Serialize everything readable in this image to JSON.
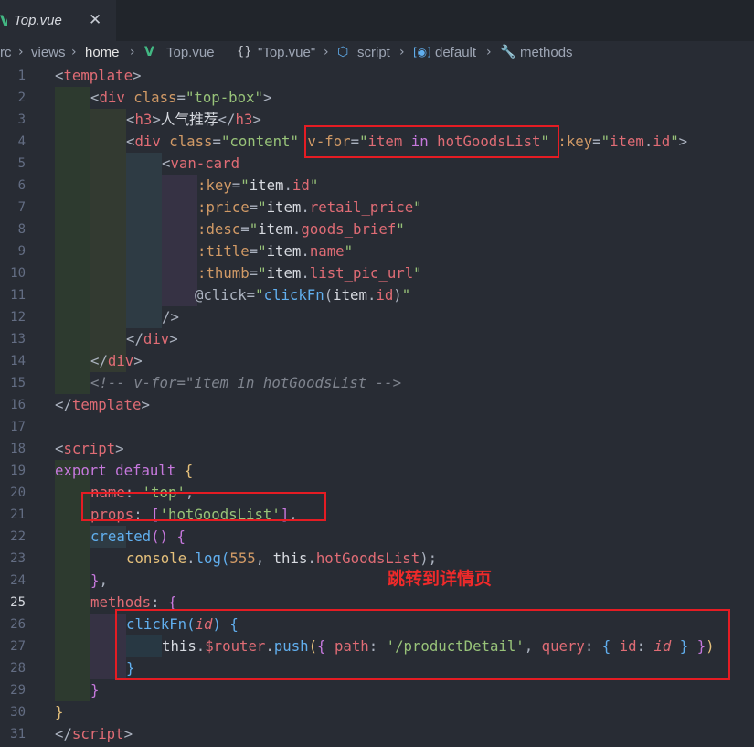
{
  "tab": {
    "icon": "vue-logo-icon",
    "title": "Top.vue",
    "close": "✕"
  },
  "breadcrumb": [
    {
      "text": "rc"
    },
    {
      "text": "views"
    },
    {
      "text": "home"
    },
    {
      "text": "Top.vue"
    },
    {
      "text": "\"Top.vue\""
    },
    {
      "text": "script"
    },
    {
      "text": "default"
    },
    {
      "text": "methods"
    }
  ],
  "line_numbers": [
    "1",
    "2",
    "3",
    "4",
    "5",
    "6",
    "7",
    "8",
    "9",
    "10",
    "11",
    "12",
    "13",
    "14",
    "15",
    "16",
    "17",
    "18",
    "19",
    "20",
    "21",
    "22",
    "23",
    "24",
    "25",
    "26",
    "27",
    "28",
    "29",
    "30",
    "31"
  ],
  "active_line": "25",
  "code": {
    "l1": [
      "<",
      "template",
      ">"
    ],
    "l2": [
      "<",
      "div",
      " ",
      "class",
      "=",
      "\"top-box\"",
      ">"
    ],
    "l3": [
      "<",
      "h3",
      ">",
      "人气推荐",
      "</",
      "h3",
      ">"
    ],
    "l4": [
      "<",
      "div",
      " ",
      "class",
      "=",
      "\"content\"",
      " ",
      "v-for",
      "=",
      "\"",
      "item",
      " ",
      "in",
      " ",
      "hotGoodsList",
      "\"",
      " ",
      ":key",
      "=",
      "\"",
      "item",
      ".",
      "id",
      "\"",
      ">"
    ],
    "l5": [
      "<",
      "van-card"
    ],
    "l6": [
      ":key",
      "=",
      "\"",
      "item",
      ".",
      "id",
      "\""
    ],
    "l7": [
      ":price",
      "=",
      "\"",
      "item",
      ".",
      "retail_price",
      "\""
    ],
    "l8": [
      ":desc",
      "=",
      "\"",
      "item",
      ".",
      "goods_brief",
      "\""
    ],
    "l9": [
      ":title",
      "=",
      "\"",
      "item",
      ".",
      "name",
      "\""
    ],
    "l10": [
      ":thumb",
      "=",
      "\"",
      "item",
      ".",
      "list_pic_url",
      "\""
    ],
    "l11": [
      "@click",
      "=",
      "\"",
      "clickFn",
      "(",
      "item",
      ".",
      "id",
      ")",
      "\""
    ],
    "l12": [
      "/>"
    ],
    "l13": [
      "</",
      "div",
      ">"
    ],
    "l14": [
      "</",
      "div",
      ">"
    ],
    "l15": [
      "<!-- v-for=\"item in hotGoodsList -->"
    ],
    "l16": [
      "</",
      "template",
      ">"
    ],
    "l18": [
      "<",
      "script",
      ">"
    ],
    "l19": [
      "export",
      " ",
      "default",
      " ",
      "{"
    ],
    "l20": [
      "name",
      ": ",
      "'top'",
      ","
    ],
    "l21": [
      "props",
      ": ",
      "[",
      "'hotGoodsList'",
      "]",
      ","
    ],
    "l22": [
      "created",
      "()",
      " ",
      "{"
    ],
    "l23": [
      "console",
      ".",
      "log",
      "(",
      "555",
      ", ",
      "this",
      ".",
      "hotGoodsList",
      ");"
    ],
    "l24": [
      "}",
      ","
    ],
    "l25": [
      "methods",
      ": ",
      "{"
    ],
    "l26": [
      "clickFn",
      "(",
      "id",
      ")",
      " ",
      "{"
    ],
    "l27": [
      "this",
      ".",
      "$router",
      ".",
      "push",
      "(",
      "{",
      " ",
      "path",
      ": ",
      "'/productDetail'",
      ", ",
      "query",
      ": ",
      "{",
      " ",
      "id",
      ": ",
      "id",
      " ",
      "}",
      " ",
      "}",
      ")"
    ],
    "l28": [
      "}"
    ],
    "l29": [
      "}"
    ],
    "l30": [
      "}"
    ],
    "l31": [
      "</",
      "script",
      ">"
    ]
  },
  "annotation": "跳转到详情页",
  "colors": {
    "background": "#282c34",
    "tag": "#e06c75",
    "attribute": "#d19a66",
    "string": "#98c379",
    "keyword": "#c678dd",
    "function": "#61afef",
    "highlight_box": "#e51c23",
    "annotation": "#ee2a2a"
  }
}
